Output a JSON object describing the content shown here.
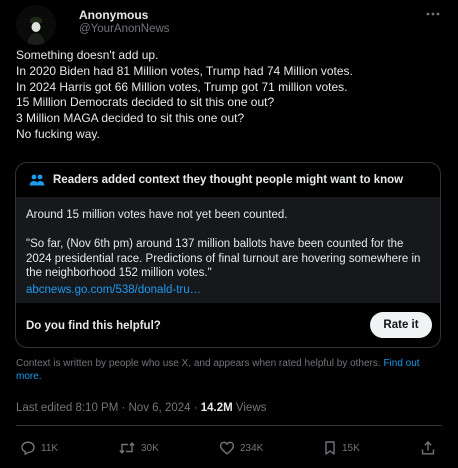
{
  "author": {
    "display_name": "Anonymous",
    "handle": "@YourAnonNews",
    "verified_badge": true
  },
  "tweet": {
    "lines": [
      "Something doesn't add up.",
      "In 2020 Biden had 81 Million votes, Trump had 74 Million votes.",
      "In 2024 Harris got 66 Million votes, Trump got 71 million votes.",
      "15 Million Democrats decided to sit this one out?",
      "3 Million MAGA decided to sit this one out?",
      "No fucking way."
    ]
  },
  "community_note": {
    "header": "Readers added context they thought people might want to know",
    "line1": "Around 15 million votes have not yet been counted.",
    "quote_lines": [
      "\"So far, (Nov 6th pm) around 137 million ballots have been counted for the",
      "2024 presidential race. Predictions of final turnout are hovering somewhere in",
      "the neighborhood 152 million votes.\""
    ],
    "link": "abcnews.go.com/538/donald-tru…",
    "helpful_question": "Do you find this helpful?",
    "rate_button": "Rate it"
  },
  "disclaimer": {
    "text": "Context is written by people who use X, and appears when rated helpful by others.",
    "link": "Find out more."
  },
  "meta": {
    "edited": "Last edited 8:10 PM · Nov 6, 2024 · ",
    "views_count": "14.2M",
    "views_label": " Views"
  },
  "actions": {
    "replies": "11K",
    "reposts": "30K",
    "likes": "234K",
    "bookmarks": "15K"
  },
  "colors": {
    "background": "#000000",
    "text": "#e7e9ea",
    "muted": "#71767b",
    "link": "#1d9bf0",
    "border": "#2f3336"
  }
}
